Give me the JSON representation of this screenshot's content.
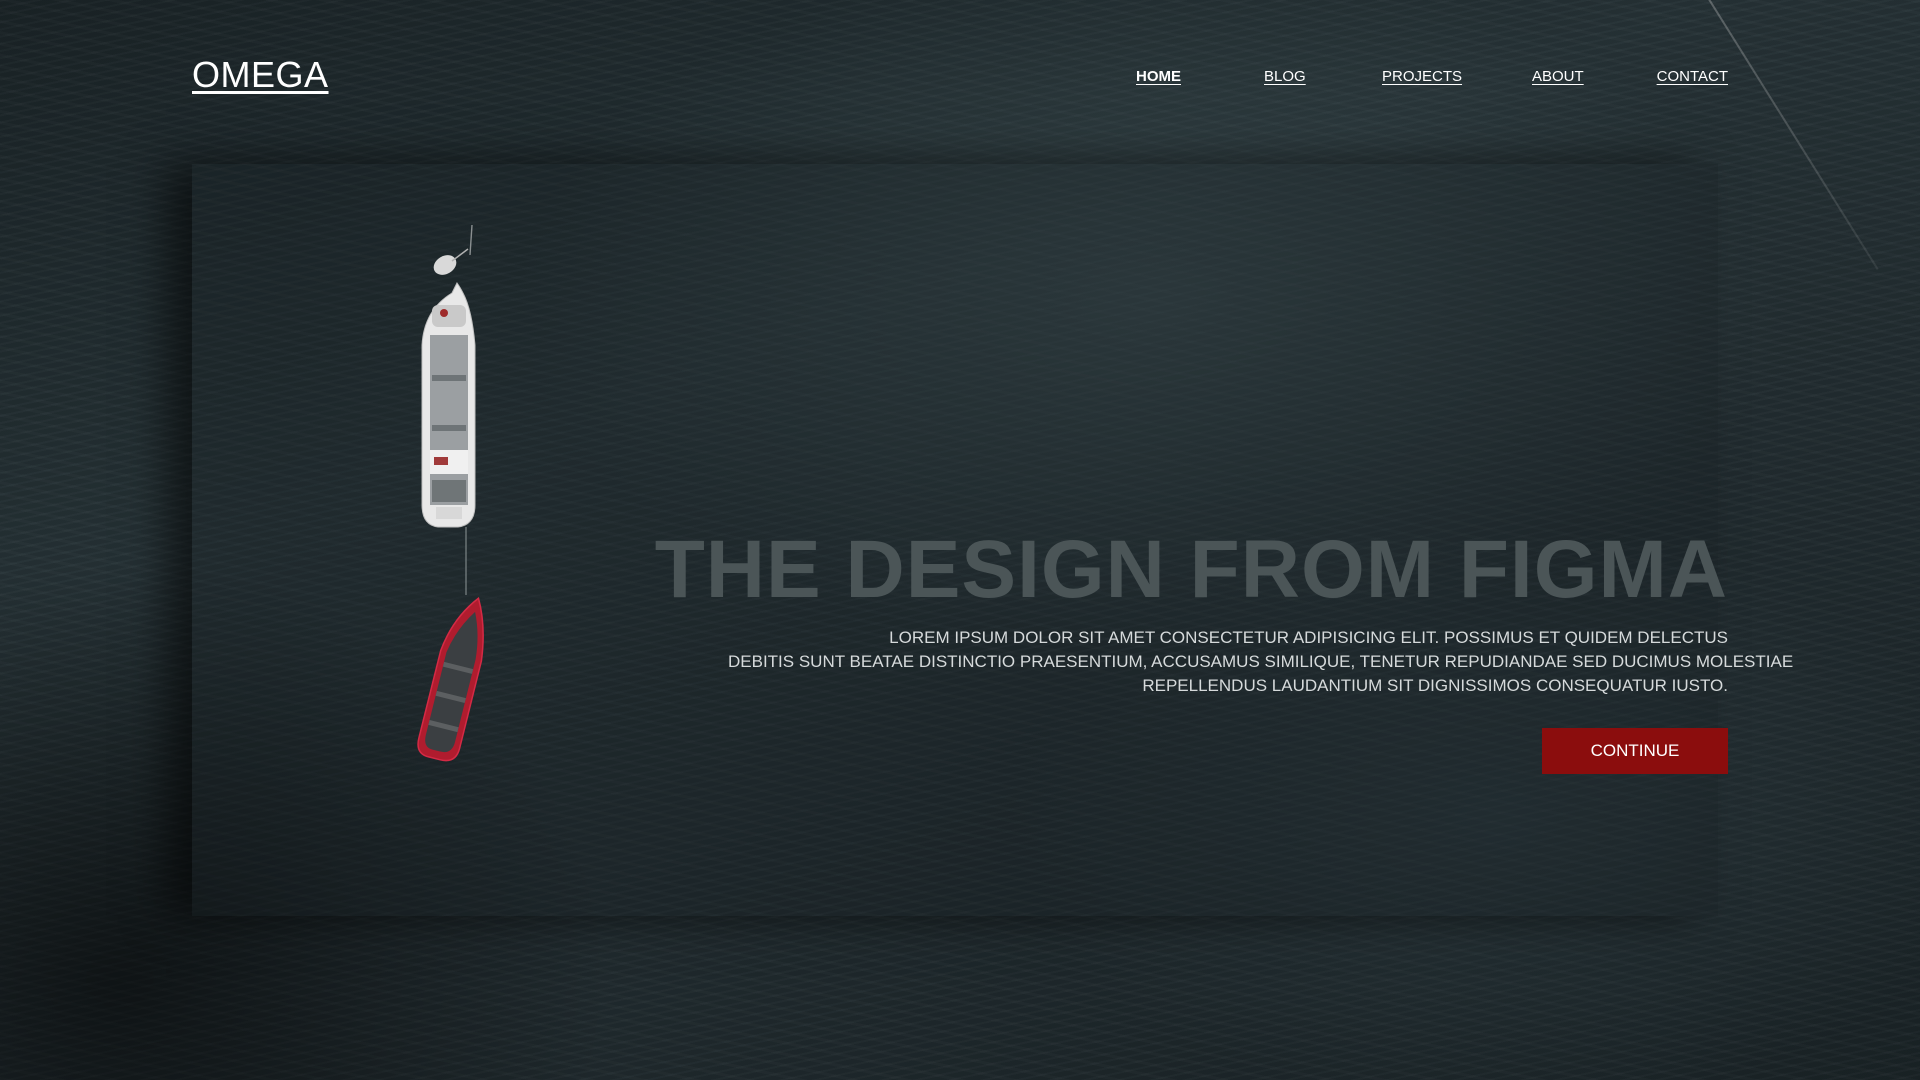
{
  "brand": {
    "logo": "OMEGA"
  },
  "nav": {
    "items": [
      {
        "label": "HOME",
        "active": true
      },
      {
        "label": "BLOG",
        "active": false
      },
      {
        "label": "PROJECTS",
        "active": false
      },
      {
        "label": "ABOUT",
        "active": false
      },
      {
        "label": "CONTACT",
        "active": false
      }
    ]
  },
  "hero": {
    "title": "THE DESIGN FROM FIGMA",
    "lines": [
      "LOREM IPSUM DOLOR SIT AMET CONSECTETUR ADIPISICING ELIT. POSSIMUS ET QUIDEM DELECTUS",
      "DEBITIS SUNT BEATAE DISTINCTIO PRAESENTIUM, ACCUSAMUS SIMILIQUE, TENETUR REPUDIANDAE SED DUCIMUS MOLESTIAE",
      "REPELLENDUS LAUDANTIUM SIT DIGNISSIMOS CONSEQUATUR IUSTO."
    ],
    "cta_label": "CONTINUE"
  },
  "colors": {
    "background": "#1f2a2e",
    "title": "#4b5557",
    "accent": "#8b0d0d",
    "text": "#ffffff"
  },
  "icons": {
    "background_image": "aerial-boats-image"
  }
}
